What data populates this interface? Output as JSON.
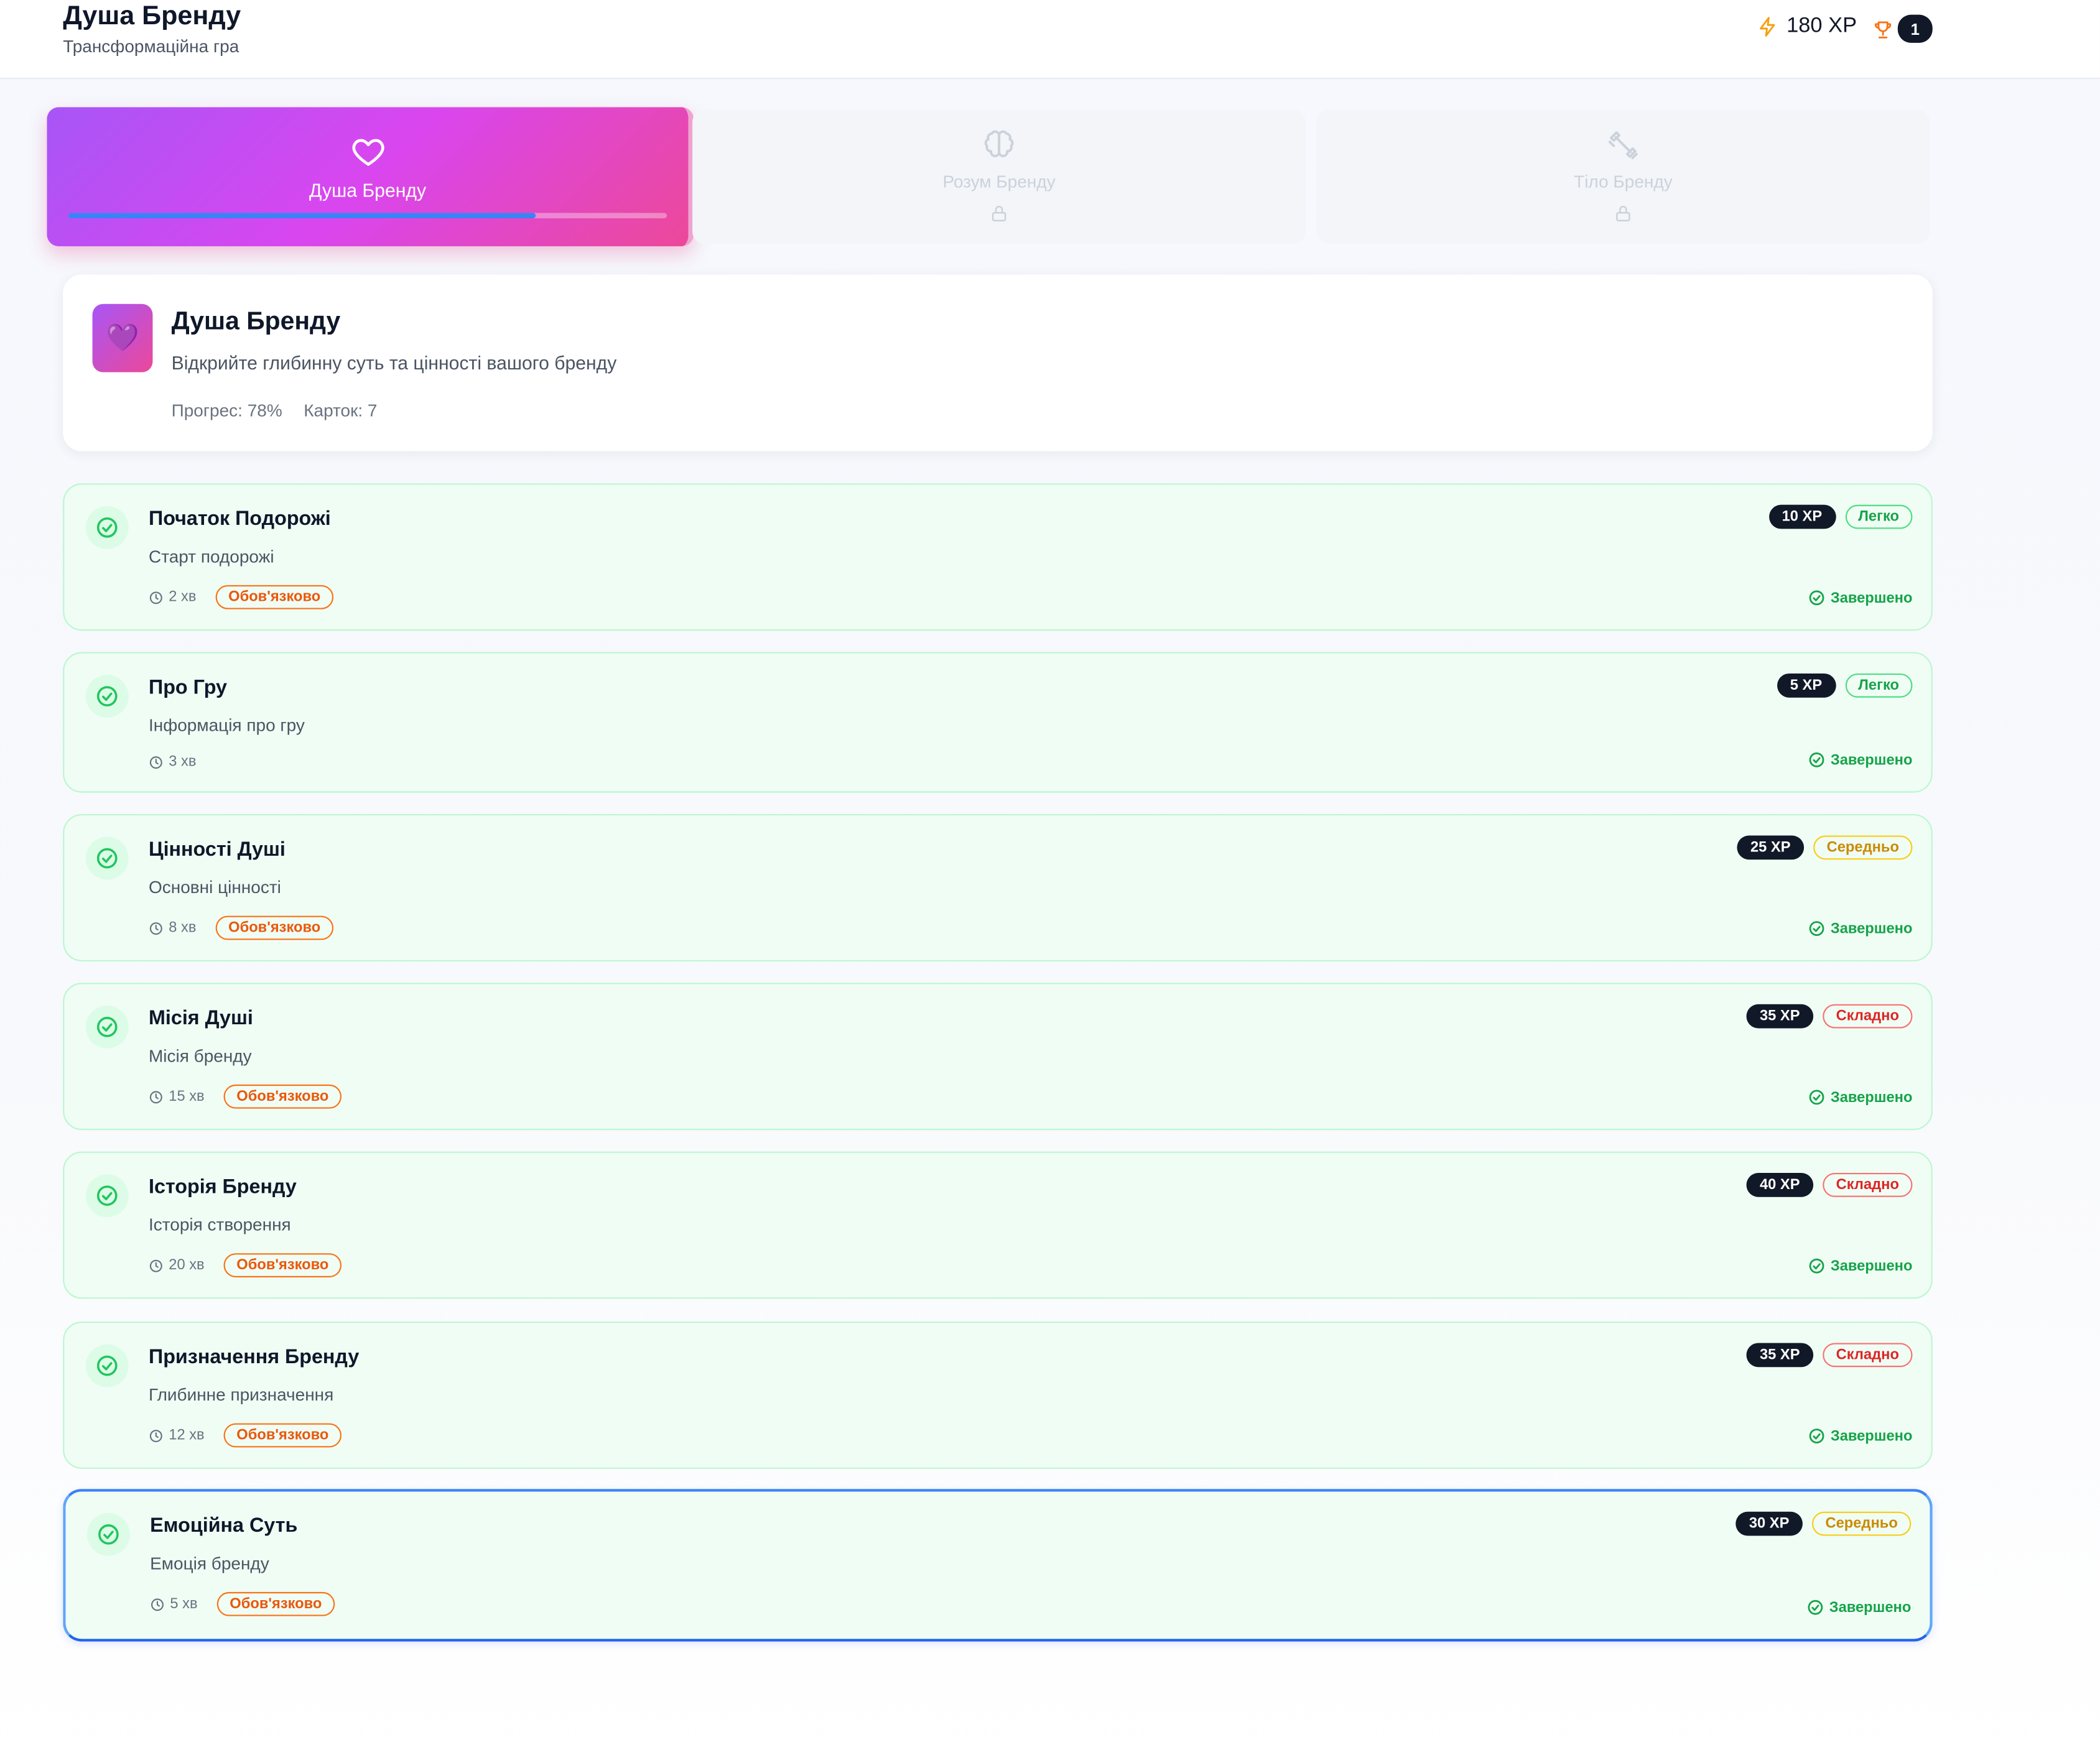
{
  "header": {
    "title": "Душа Бренду",
    "subtitle": "Трансформаційна гра",
    "xp": "180 XP",
    "trophy_count": "1"
  },
  "tabs": [
    {
      "label": "Душа Бренду",
      "icon": "heart-icon",
      "active": true,
      "progress": 0.78
    },
    {
      "label": "Розум Бренду",
      "icon": "brain-icon",
      "locked": true
    },
    {
      "label": "Тіло Бренду",
      "icon": "dumbbell-icon",
      "locked": true
    }
  ],
  "section": {
    "emoji": "💜",
    "title": "Душа Бренду",
    "description": "Відкрийте глибинну суть та цінності вашого бренду",
    "progress_text": "Прогрес: 78%",
    "cards_text": "Карток: 7"
  },
  "cards": [
    {
      "title": "Початок Подорожі",
      "subtitle": "Старт подорожі",
      "time": "2 хв",
      "mandatory": "Обов'язково",
      "xp": "10 XP",
      "difficulty": "Легко",
      "level": "easy",
      "status": "Завершено"
    },
    {
      "title": "Про Гру",
      "subtitle": "Інформація про гру",
      "time": "3 хв",
      "mandatory": "",
      "xp": "5 XP",
      "difficulty": "Легко",
      "level": "easy",
      "status": "Завершено"
    },
    {
      "title": "Цінності Душі",
      "subtitle": "Основні цінності",
      "time": "8 хв",
      "mandatory": "Обов'язково",
      "xp": "25 XP",
      "difficulty": "Середньо",
      "level": "medium",
      "status": "Завершено"
    },
    {
      "title": "Місія Душі",
      "subtitle": "Місія бренду",
      "time": "15 хв",
      "mandatory": "Обов'язково",
      "xp": "35 XP",
      "difficulty": "Складно",
      "level": "hard",
      "status": "Завершено"
    },
    {
      "title": "Історія Бренду",
      "subtitle": "Історія створення",
      "time": "20 хв",
      "mandatory": "Обов'язково",
      "xp": "40 XP",
      "difficulty": "Складно",
      "level": "hard",
      "status": "Завершено"
    },
    {
      "title": "Призначення Бренду",
      "subtitle": "Глибинне призначення",
      "time": "12 хв",
      "mandatory": "Обов'язково",
      "xp": "35 XP",
      "difficulty": "Складно",
      "level": "hard",
      "status": "Завершено"
    },
    {
      "title": "Емоційна Суть",
      "subtitle": "Емоція бренду",
      "time": "5 хв",
      "mandatory": "Обов'язково",
      "xp": "30 XP",
      "difficulty": "Середньо",
      "level": "medium",
      "status": "Завершено",
      "selected": true
    }
  ]
}
